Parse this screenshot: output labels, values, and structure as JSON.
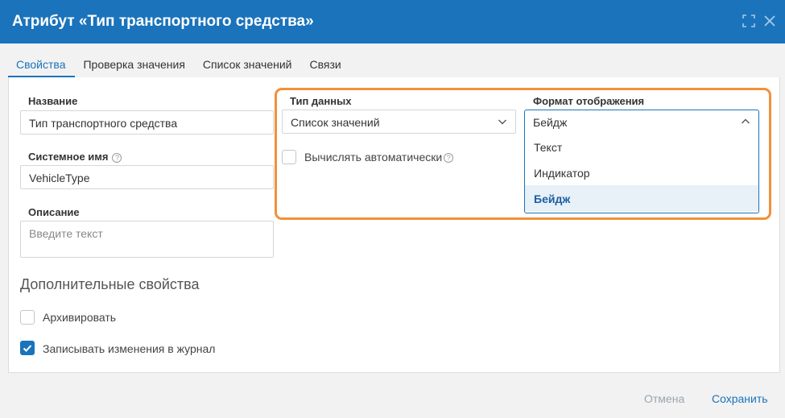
{
  "dialog": {
    "title": "Атрибут «Тип транспортного средства»"
  },
  "tabs": [
    {
      "label": "Свойства",
      "active": true
    },
    {
      "label": "Проверка значения",
      "active": false
    },
    {
      "label": "Список значений",
      "active": false
    },
    {
      "label": "Связи",
      "active": false
    }
  ],
  "form": {
    "name_label": "Название",
    "name_value": "Тип транспортного средства",
    "system_name_label": "Системное имя",
    "system_name_value": "VehicleType",
    "description_label": "Описание",
    "description_placeholder": "Введите текст",
    "data_type_label": "Тип данных",
    "data_type_value": "Список значений",
    "auto_calc_label": "Вычислять автоматически",
    "auto_calc_checked": false,
    "display_format_label": "Формат отображения",
    "display_format_value": "Бейдж",
    "display_format_options": [
      {
        "label": "Текст",
        "selected": false
      },
      {
        "label": "Индикатор",
        "selected": false
      },
      {
        "label": "Бейдж",
        "selected": true
      }
    ]
  },
  "additional": {
    "title": "Дополнительные свойства",
    "archive_label": "Архивировать",
    "archive_checked": false,
    "log_label": "Записывать изменения в журнал",
    "log_checked": true
  },
  "footer": {
    "cancel_label": "Отмена",
    "save_label": "Сохранить"
  },
  "colors": {
    "accent": "#1a73bb",
    "highlight": "#f0913a"
  },
  "icons": {
    "help": "question-circle-icon",
    "maximize": "maximize-icon",
    "close": "close-icon",
    "chevron_down": "chevron-down-icon",
    "chevron_up": "chevron-up-icon",
    "check": "check-icon"
  }
}
